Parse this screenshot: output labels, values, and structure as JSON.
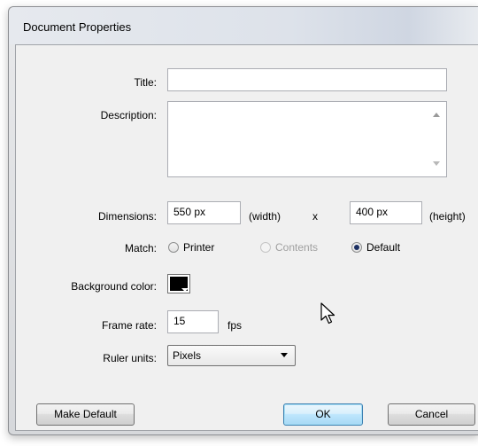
{
  "window": {
    "title": "Document Properties"
  },
  "fields": {
    "title_label": "Title:",
    "title_value": "",
    "description_label": "Description:",
    "description_value": "",
    "dimensions_label": "Dimensions:",
    "width_value": "550 px",
    "width_hint": "(width)",
    "by": "x",
    "height_value": "400 px",
    "height_hint": "(height)",
    "match_label": "Match:",
    "match_options": [
      {
        "label": "Printer",
        "checked": false,
        "disabled": false
      },
      {
        "label": "Contents",
        "checked": false,
        "disabled": true
      },
      {
        "label": "Default",
        "checked": true,
        "disabled": false
      }
    ],
    "bgcolor_label": "Background color:",
    "bgcolor_value": "#000000",
    "framerate_label": "Frame rate:",
    "framerate_value": "15",
    "framerate_unit": "fps",
    "ruler_label": "Ruler units:",
    "ruler_value": "Pixels"
  },
  "buttons": {
    "make_default": "Make Default",
    "ok": "OK",
    "cancel": "Cancel"
  },
  "icons": {
    "scroll_up": "scroll-up-arrow-icon",
    "scroll_down": "scroll-down-arrow-icon",
    "dropdown": "chevron-down-icon",
    "cursor": "mouse-pointer-icon"
  }
}
